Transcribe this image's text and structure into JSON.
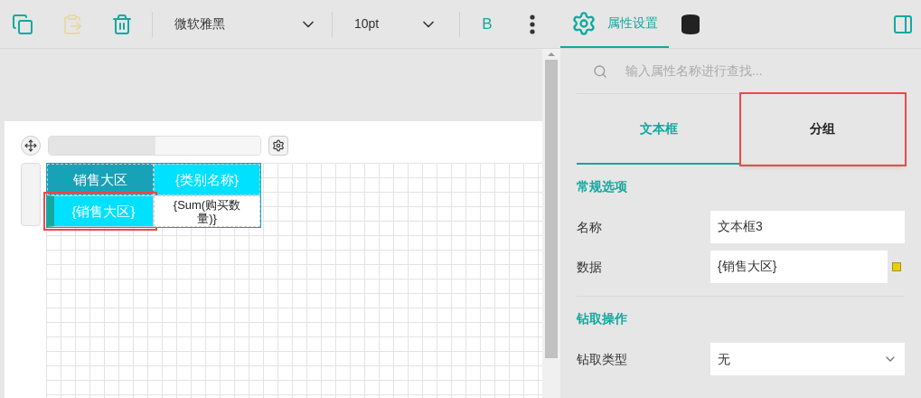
{
  "toolbar": {
    "font": "微软雅黑",
    "font_size": "10pt",
    "bold": "B"
  },
  "panel_tabs": [
    {
      "kind": "gear",
      "label": "属性设置",
      "selected": true
    },
    {
      "kind": "database",
      "selected": false
    }
  ],
  "search": {
    "placeholder": "输入属性名称进行查找..."
  },
  "sub_tabs": [
    {
      "label": "文本框",
      "selected": true,
      "highlighted": false
    },
    {
      "label": "分组",
      "selected": false,
      "highlighted": true
    }
  ],
  "sections": [
    {
      "title": "常规选项",
      "fields": [
        {
          "kind": "text",
          "label": "名称",
          "value": "文本框3"
        },
        {
          "kind": "expression",
          "label": "数据",
          "value": "{销售大区}"
        }
      ]
    },
    {
      "title": "钻取操作",
      "fields": [
        {
          "kind": "select",
          "label": "钻取类型",
          "value": "无"
        }
      ]
    }
  ],
  "table": {
    "rows": [
      [
        {
          "kind": "header",
          "text": "销售大区",
          "highlighted": false
        },
        {
          "kind": "group",
          "text": "{类别名称}",
          "highlighted": false
        }
      ],
      [
        {
          "kind": "group",
          "text": "{销售大区}",
          "highlighted": true
        },
        {
          "kind": "detail",
          "text": "{Sum(购买数量)}",
          "highlighted": false
        }
      ]
    ]
  }
}
